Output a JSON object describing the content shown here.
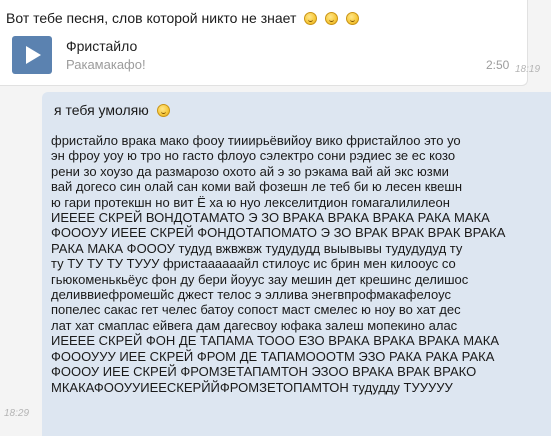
{
  "incoming": {
    "text": "Вот тебе песня, слов которой никто не знает",
    "emoji_count": 3,
    "emoji_icon": "smiley-emoji-icon",
    "audio": {
      "title": "Фристайло",
      "artist": "Ракамакафо!",
      "duration": "2:50",
      "play_icon": "play-icon",
      "accent_color": "#5b82b0"
    },
    "time": "18:19"
  },
  "outgoing": {
    "greeting": "я тебя умоляю",
    "greeting_emoji": "smirk-emoji-icon",
    "body_lines": [
      "фристайло врака мако фоoу тииирьёвийоу вико фристайлоо это уо",
      "эн фроу уоу ю тро но гасто флоуо сэлектро сони рэдиес зе ес козо",
      "рени зо хоузо да размарозо охото ай э зо рэкама вай ай экс юзми",
      "вай догесо син олай сан коми вай фозешн ле теб би ю лесен квешн",
      "ю гари протекшн но вит Ё ха ю нуо лекселитдион гомагалилилеон",
      "ИЕЕЕЕ СКРЕЙ ВОНДОТАМАТО Э ЗО ВРАКА ВРАКА ВРАКА РАКА МАКА",
      "ФОООУУ ИЕЕЕ СКРЕЙ ФОНДОТАПОМАТО Э ЗО ВРАК ВРАК ВРАК ВРАКА",
      "РАКА МАКА ФОООУ тудуд вжвжвж тудудудд выывывы тудудудуд ту",
      "ту ТУ ТУ ТУ ТУУУ фристаааааайл стилоус ис брин мен килооус со",
      "гьюкоменькьёус фон ду бери йоуус зау мешин дет крешинс делишос",
      "деливвиефромешйс джест телос э эллива энегвпрофмакафелоус",
      "попелес сакас гет челес батоу сопост маст смелес ю ноу во хат дес",
      "лат хат смаплас ейвега дам дагесвоу юфака залеш мопекино алас",
      "ИЕЕЕЕ СКРЕЙ ФОН ДЕ ТАПАМА ТООО ЕЗО ВРАКА ВРАКА ВРАКА МАКА",
      "ФОООУУУ ИЕЕ СКРЕЙ ФРОМ ДЕ ТАПАМОООТМ ЭЗО РАКА РАКА РАКА",
      "ФОООУ ИЕЕ СКРЕЙ ФРОМЗЕТАПАМТОН ЭЗОО ВРАКА ВРАК ВРАКО",
      "МКАКАФООУУИЕЕСКЕРЙЙФРОМЗЕТОПАМТОН тудудду ТУУУУУ"
    ],
    "time": "18:29",
    "bubble_color": "#dde6f1"
  }
}
